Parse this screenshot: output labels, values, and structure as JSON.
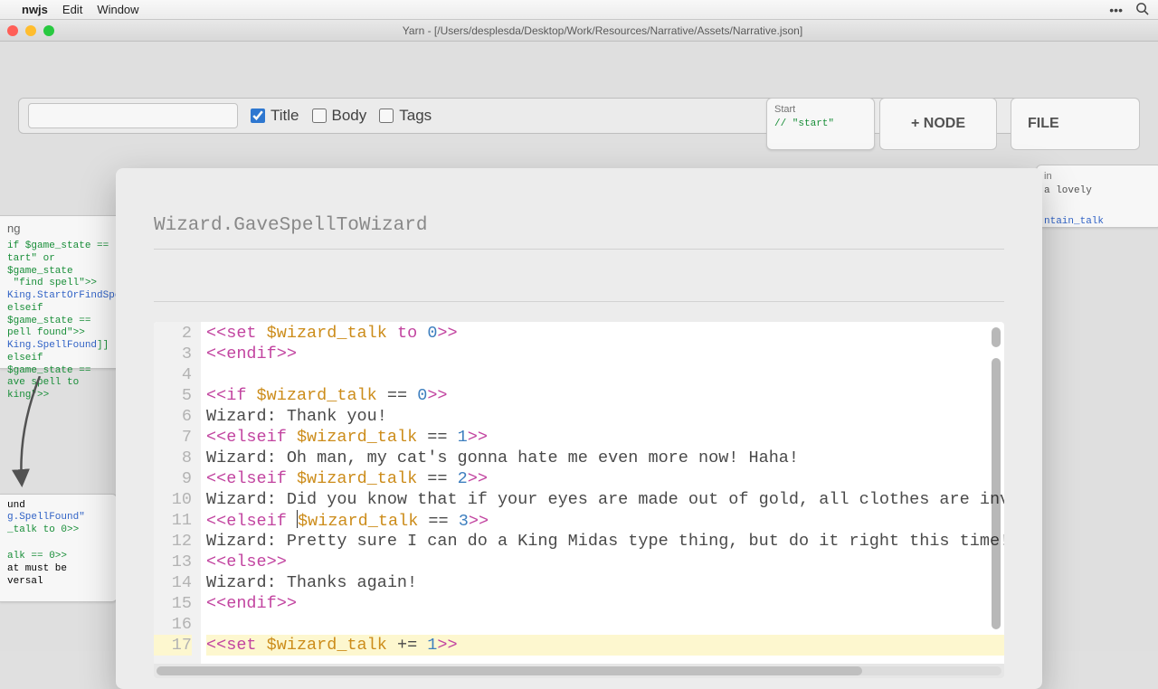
{
  "menubar": {
    "app": "nwjs",
    "items": [
      "Edit",
      "Window"
    ]
  },
  "window": {
    "title": "Yarn - [/Users/desplesda/Desktop/Work/Resources/Narrative/Assets/Narrative.json]"
  },
  "toolbar": {
    "search_placeholder": "",
    "filters": {
      "title": "Title",
      "body": "Body",
      "tags": "Tags"
    },
    "title_checked": true,
    "body_checked": false,
    "tags_checked": false,
    "add_node_label": "+ NODE",
    "file_label": "FILE"
  },
  "bg_nodes": {
    "start": {
      "header": "Start",
      "line": "// \"start\""
    },
    "fountain": {
      "partial_header": "in",
      "l1": "a lovely",
      "l2": "ntain_talk"
    },
    "left": {
      "header": "ng",
      "text": "if $game_state ==\ntart\" or $game_state\n \"find spell\">>\nKing.StartOrFindSpell\nelseif $game_state ==\npell found\">>\nKing.SpellFound]]\nelseif $game_state ==\nave spell to king\">>"
    },
    "found": {
      "header": "und",
      "text": "g.SpellFound\"\n_talk to 0>>\n\nalk == 0>>\nat must be\nversal"
    }
  },
  "modal": {
    "title": "Wizard.GaveSpellToWizard",
    "first_line_number": 2,
    "highlighted_line_number": 17,
    "lines": [
      {
        "n": 2,
        "segs": [
          [
            "punc",
            "<<"
          ],
          [
            "kwp",
            "set"
          ],
          [
            "",
            " "
          ],
          [
            "var",
            "$wizard_talk"
          ],
          [
            "",
            " "
          ],
          [
            "kwp",
            "to"
          ],
          [
            "",
            " "
          ],
          [
            "num",
            "0"
          ],
          [
            "punc",
            ">>"
          ]
        ]
      },
      {
        "n": 3,
        "segs": [
          [
            "punc",
            "<<"
          ],
          [
            "kwp",
            "endif"
          ],
          [
            "punc",
            ">>"
          ]
        ]
      },
      {
        "n": 4,
        "segs": [
          [
            "",
            ""
          ]
        ]
      },
      {
        "n": 5,
        "segs": [
          [
            "punc",
            "<<"
          ],
          [
            "kwp",
            "if"
          ],
          [
            "",
            " "
          ],
          [
            "var",
            "$wizard_talk"
          ],
          [
            "",
            " == "
          ],
          [
            "num",
            "0"
          ],
          [
            "punc",
            ">>"
          ]
        ]
      },
      {
        "n": 6,
        "segs": [
          [
            "",
            "Wizard: Thank you!"
          ]
        ]
      },
      {
        "n": 7,
        "segs": [
          [
            "punc",
            "<<"
          ],
          [
            "kwp",
            "elseif"
          ],
          [
            "",
            " "
          ],
          [
            "var",
            "$wizard_talk"
          ],
          [
            "",
            " == "
          ],
          [
            "num",
            "1"
          ],
          [
            "punc",
            ">>"
          ]
        ]
      },
      {
        "n": 8,
        "segs": [
          [
            "",
            "Wizard: Oh man, my cat's gonna hate me even more now! Haha!"
          ]
        ]
      },
      {
        "n": 9,
        "segs": [
          [
            "punc",
            "<<"
          ],
          [
            "kwp",
            "elseif"
          ],
          [
            "",
            " "
          ],
          [
            "var",
            "$wizard_talk"
          ],
          [
            "",
            " == "
          ],
          [
            "num",
            "2"
          ],
          [
            "punc",
            ">>"
          ]
        ]
      },
      {
        "n": 10,
        "segs": [
          [
            "",
            "Wizard: Did you know that if your eyes are made out of gold, all clothes are invis"
          ]
        ]
      },
      {
        "n": 11,
        "segs": [
          [
            "punc",
            "<<"
          ],
          [
            "kwp",
            "elseif"
          ],
          [
            "",
            " "
          ],
          [
            "var",
            "$wizard_talk"
          ],
          [
            "",
            " == "
          ],
          [
            "num",
            "3"
          ],
          [
            "punc",
            ">>"
          ]
        ],
        "caret_after": 9
      },
      {
        "n": 12,
        "segs": [
          [
            "",
            "Wizard: Pretty sure I can do a King Midas type thing, but do it right this time!"
          ]
        ]
      },
      {
        "n": 13,
        "segs": [
          [
            "punc",
            "<<"
          ],
          [
            "kwp",
            "else"
          ],
          [
            "punc",
            ">>"
          ]
        ]
      },
      {
        "n": 14,
        "segs": [
          [
            "",
            "Wizard: Thanks again!"
          ]
        ]
      },
      {
        "n": 15,
        "segs": [
          [
            "punc",
            "<<"
          ],
          [
            "kwp",
            "endif"
          ],
          [
            "punc",
            ">>"
          ]
        ]
      },
      {
        "n": 16,
        "segs": [
          [
            "",
            ""
          ]
        ]
      },
      {
        "n": 17,
        "segs": [
          [
            "punc",
            "<<"
          ],
          [
            "kwp",
            "set"
          ],
          [
            "",
            " "
          ],
          [
            "var",
            "$wizard_talk"
          ],
          [
            "",
            " += "
          ],
          [
            "num",
            "1"
          ],
          [
            "punc",
            ">>"
          ]
        ],
        "current": true
      }
    ]
  }
}
